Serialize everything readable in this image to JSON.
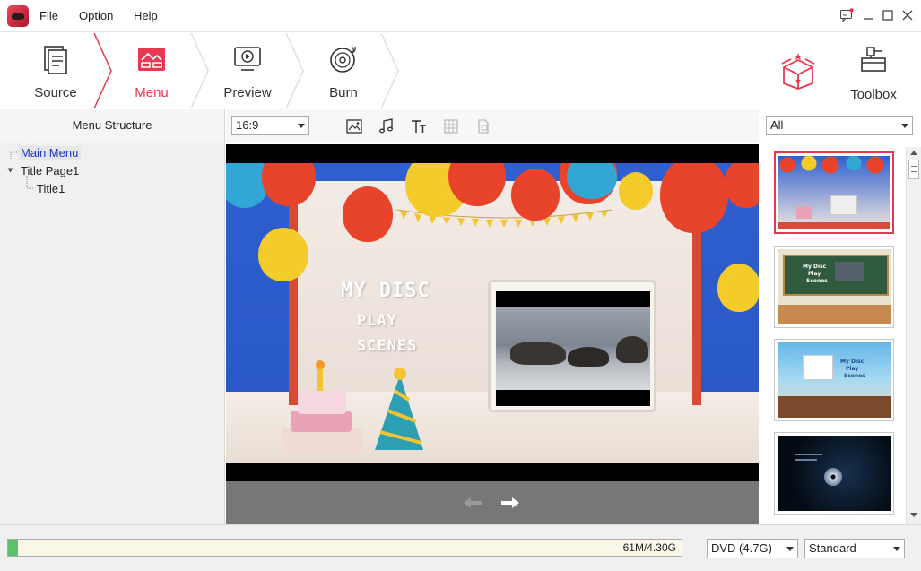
{
  "menubar": {
    "file": "File",
    "option": "Option",
    "help": "Help"
  },
  "steps": [
    {
      "label": "Source",
      "icon": "source-document-icon"
    },
    {
      "label": "Menu",
      "icon": "menu-image-icon",
      "active": true
    },
    {
      "label": "Preview",
      "icon": "preview-play-icon"
    },
    {
      "label": "Burn",
      "icon": "burn-disc-icon"
    }
  ],
  "toolbox": {
    "label": "Toolbox"
  },
  "left_panel": {
    "title": "Menu Structure",
    "tree": [
      {
        "label": "Main Menu",
        "selected": true
      },
      {
        "label": "Title Page1"
      },
      {
        "label": "Title1"
      }
    ]
  },
  "editor": {
    "aspect_ratio": "16:9",
    "tools": [
      "image-icon",
      "music-icon",
      "text-icon",
      "chapter-icon",
      "copy-icon"
    ]
  },
  "preview_menu": {
    "title": "MY DISC",
    "play": "PLAY",
    "scenes": "SCENES"
  },
  "templates": {
    "filter": "All",
    "items": [
      {
        "name": "birthday-template",
        "selected": true
      },
      {
        "name": "classroom-template",
        "text": [
          "My Disc",
          "Play",
          "Scenes"
        ]
      },
      {
        "name": "beach-template",
        "text": [
          "My Disc",
          "Play",
          "Scenes"
        ]
      },
      {
        "name": "dark-disc-template"
      }
    ]
  },
  "status": {
    "usage_text": "61M/4.30G",
    "usage_fraction": 0.014,
    "disc_type": "DVD (4.7G)",
    "quality": "Standard"
  },
  "colors": {
    "accent": "#e8384f",
    "selected_text": "#1a35c9"
  }
}
